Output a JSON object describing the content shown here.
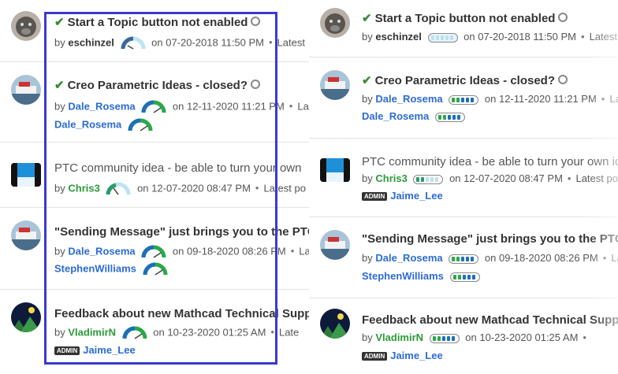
{
  "topics": [
    {
      "title": "Start a Topic button not enabled",
      "title_full": "Start a Topic button not enabled",
      "solved": true,
      "by": "by",
      "author": "eschinzel",
      "date": "on 07-20-2018 11:50 PM",
      "latest": "Latest",
      "latest_short": "La",
      "second_user": "",
      "second_admin": "",
      "avatar": "gorilla-avatar"
    },
    {
      "title": "Creo Parametric Ideas - closed?",
      "title_full": "Creo Parametric Ideas - closed?",
      "solved": true,
      "by": "by",
      "author": "Dale_Rosema",
      "date": "on 12-11-2020 11:21 PM",
      "latest": "La",
      "second_user": "Dale_Rosema",
      "second_admin": "",
      "avatar": "ship-avatar"
    },
    {
      "title": "PTC community idea - be able to turn your own",
      "title_full": "PTC community idea - be able to turn your own ic",
      "solved": false,
      "by": "by",
      "author": "Chris3",
      "date": "on 12-07-2020 08:47 PM",
      "latest": "Latest po",
      "second_user": "Jaime_Lee",
      "second_admin": "ADMIN",
      "avatar": "landscape-avatar"
    },
    {
      "title": "\"Sending Message\" just brings you to the PTC m",
      "title_full": "\"Sending Message\" just brings you to the PTC me",
      "solved": false,
      "by": "by",
      "author": "Dale_Rosema",
      "date": "on 09-18-2020 08:26 PM",
      "latest": "La",
      "second_user": "StephenWilliams",
      "second_admin": "",
      "avatar": "ship-avatar"
    },
    {
      "title": "Feedback about new Mathcad Technical Suppo",
      "title_full": "Feedback about new Mathcad Technical Suppor",
      "solved": false,
      "by": "by",
      "author": "VladimirN",
      "date": "on 10-23-2020 01:25 AM",
      "latest": "Late",
      "second_user": "Jaime_Lee",
      "second_admin": "ADMIN",
      "avatar": "night-sky-avatar"
    }
  ],
  "colors": {
    "accent_blue": "#2c6cd2",
    "solved_green": "#3a8b3a",
    "highlight": "#3a3ad0"
  }
}
